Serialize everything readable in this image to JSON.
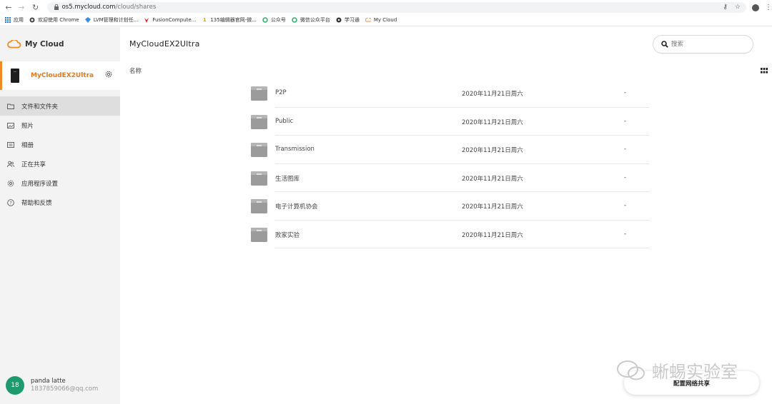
{
  "browser": {
    "url_host": "os5.mycloud.com",
    "url_path": "/cloud/shares",
    "bookmarks": [
      {
        "label": "应用",
        "icon": "apps-grid-icon"
      },
      {
        "label": "欢迎使用 Chrome",
        "icon": "chrome-icon"
      },
      {
        "label": "LVM管理和计划任...",
        "icon": "diamond-icon"
      },
      {
        "label": "FusionCompute...",
        "icon": "huawei-icon"
      },
      {
        "label": "135编辑器官网-微...",
        "icon": "editor135-icon"
      },
      {
        "label": "公众号",
        "icon": "wechat-mp-icon"
      },
      {
        "label": "微信公众平台",
        "icon": "wechat-mp-icon"
      },
      {
        "label": "学习通",
        "icon": "globe-icon"
      },
      {
        "label": "My Cloud",
        "icon": "mycloud-icon"
      }
    ]
  },
  "sidebar": {
    "brand": "My Cloud",
    "device_name": "MyCloudEX2Ultra",
    "items": [
      {
        "label": "文件和文件夹",
        "icon": "folder-icon",
        "active": true
      },
      {
        "label": "照片",
        "icon": "photo-icon",
        "active": false
      },
      {
        "label": "相册",
        "icon": "album-icon",
        "active": false
      },
      {
        "label": "正在共享",
        "icon": "people-icon",
        "active": false
      },
      {
        "label": "应用程序设置",
        "icon": "gear-icon",
        "active": false
      },
      {
        "label": "帮助和反馈",
        "icon": "help-icon",
        "active": false
      }
    ],
    "user": {
      "avatar_text": "18",
      "name": "panda latte",
      "email": "1837859066@qq.com",
      "avatar_color": "#1e9b6e"
    }
  },
  "main": {
    "title": "MyCloudEX2Ultra",
    "column_name": "名称",
    "search_placeholder": "搜索",
    "files": [
      {
        "name": "P2P",
        "date": "2020年11月21日周六",
        "size": "-"
      },
      {
        "name": "Public",
        "date": "2020年11月21日周六",
        "size": "-"
      },
      {
        "name": "Transmission",
        "date": "2020年11月21日周六",
        "size": "-"
      },
      {
        "name": "生活图库",
        "date": "2020年11月21日周六",
        "size": "-"
      },
      {
        "name": "电子计算机协会",
        "date": "2020年11月21日周六",
        "size": "-"
      },
      {
        "name": "败家实验",
        "date": "2020年11月21日周六",
        "size": "-"
      }
    ],
    "config_button": "配置网络共享"
  },
  "watermark": "蜥蜴实验室",
  "colors": {
    "accent": "#f08a24",
    "device_text": "#e6791b",
    "sidebar_bg": "#f3f3f3",
    "active_nav_bg": "#dedede"
  }
}
